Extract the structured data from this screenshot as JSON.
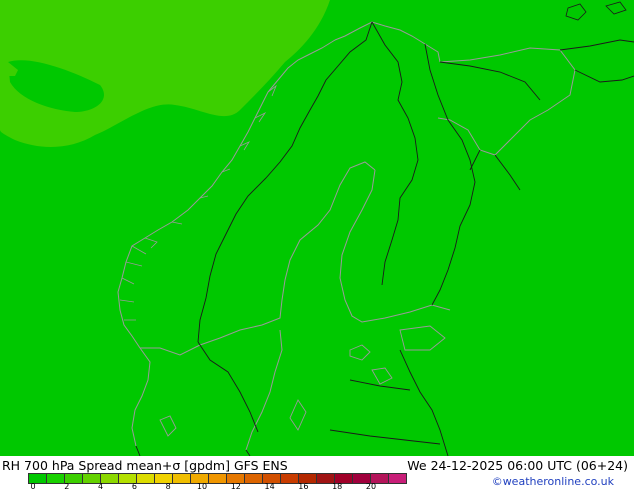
{
  "title_left": "RH 700 hPa Spread mean+σ [gpdm] GFS ENS",
  "title_right": "We 24-12-2025 06:00 UTC (06+24)",
  "credit": "©weatheronline.co.uk",
  "colors": {
    "field_main": "#00c800",
    "field_high": "#3ccf00",
    "coastline": "#9a9a9a",
    "border": "#1a1a1a"
  },
  "legend": {
    "colors": [
      "#00c800",
      "#19d100",
      "#3ccf00",
      "#64d200",
      "#8cd800",
      "#b4e000",
      "#dcdc00",
      "#f0d200",
      "#f0be00",
      "#f0aa00",
      "#f09600",
      "#e67800",
      "#dc6400",
      "#d25000",
      "#c83c00",
      "#b42800",
      "#a01414",
      "#a00028",
      "#a0003c",
      "#b4145a",
      "#c81e78"
    ],
    "ticks": [
      "0",
      "2",
      "4",
      "6",
      "8",
      "10",
      "12",
      "14",
      "16",
      "18",
      "20"
    ]
  }
}
